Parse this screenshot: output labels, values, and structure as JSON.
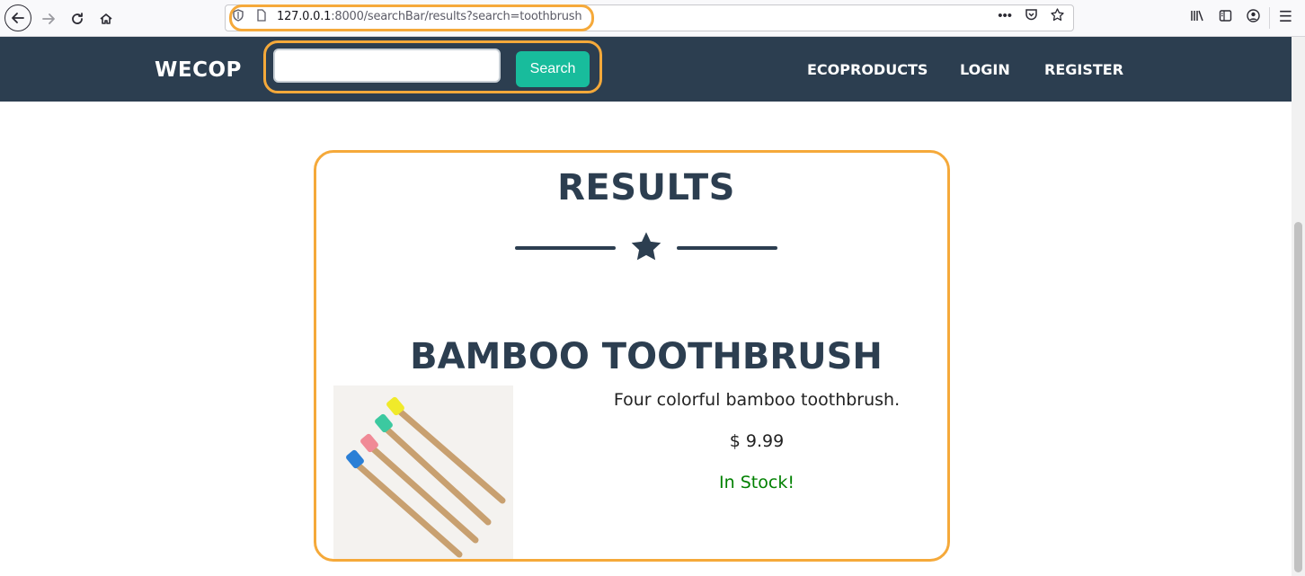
{
  "browser": {
    "url_host": "127.0.0.1",
    "url_rest": ":8000/searchBar/results?search=toothbrush"
  },
  "navbar": {
    "brand": "WECOP",
    "search": {
      "value": "",
      "placeholder": "",
      "button_label": "Search"
    },
    "links": [
      {
        "label": "ECOPRODUCTS"
      },
      {
        "label": "LOGIN"
      },
      {
        "label": "REGISTER"
      }
    ]
  },
  "results": {
    "title": "RESULTS",
    "divider_icon": "star-icon",
    "products": [
      {
        "name": "BAMBOO TOOTHBRUSH",
        "description": "Four colorful bamboo toothbrush.",
        "price": "$ 9.99",
        "stock": "In Stock!",
        "image_icon": "toothbrush-image"
      }
    ]
  },
  "colors": {
    "navbar_bg": "#2c3e50",
    "accent": "#18bc9c",
    "highlight": "#f5a93a",
    "stock": "#008000"
  }
}
